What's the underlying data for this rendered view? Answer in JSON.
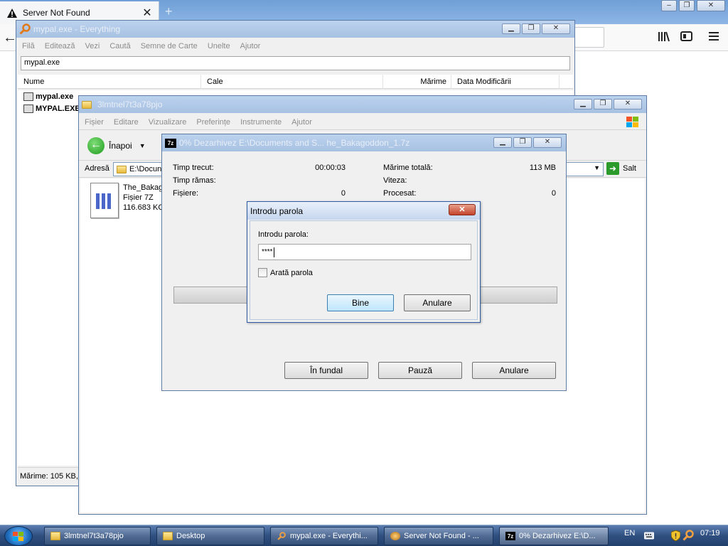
{
  "browser": {
    "tab_title": "Server Not Found",
    "tab_close": "✕",
    "new_tab": "+",
    "back": "←",
    "window_controls": [
      "–",
      "❐",
      "✕"
    ],
    "toolbar_icons": [
      "library-icon",
      "sidebar-icon",
      "menu-icon"
    ]
  },
  "everything": {
    "title": "mypal.exe - Everything",
    "menu": [
      "Filă",
      "Editează",
      "Vezi",
      "Caută",
      "Semne de Carte",
      "Unelte",
      "Ajutor"
    ],
    "search_value": "mypal.exe",
    "columns": [
      "Nume",
      "Cale",
      "Mărime",
      "Data Modificării"
    ],
    "rows": [
      {
        "name": "mypal.exe"
      },
      {
        "name": "MYPAL.EXE"
      }
    ],
    "status": "Mărime: 105 KB, I"
  },
  "explorer": {
    "title": "3lmtnel7t3a78pjo",
    "menu": [
      "Fișier",
      "Editare",
      "Vizualizare",
      "Preferințe",
      "Instrumente",
      "Ajutor"
    ],
    "back_label": "Înapoi",
    "address_label": "Adresă",
    "address_value": "E:\\Docun",
    "go_label": "Salt",
    "file": {
      "name": "The_Bakag",
      "type": "Fișier 7Z",
      "size": "116.683 KC"
    }
  },
  "progress": {
    "title": "0% Dezarhivez E:\\Documents and S... he_Bakagoddon_1.7z",
    "labels": {
      "elapsed": "Timp trecut:",
      "remaining": "Timp rămas:",
      "files": "Fișiere:",
      "total_size": "Mărime totală:",
      "speed": "Viteza:",
      "processed": "Procesat:"
    },
    "values": {
      "elapsed": "00:00:03",
      "files": "0",
      "total_size": "113 MB",
      "processed": "0"
    },
    "percent": 0,
    "buttons": {
      "background": "În fundal",
      "pause": "Pauză",
      "cancel": "Anulare"
    }
  },
  "password_dialog": {
    "title": "Introdu parola",
    "label": "Introdu parola:",
    "masked_value": "****",
    "show_password": "Arată parola",
    "ok": "Bine",
    "cancel": "Anulare",
    "close": "✕"
  },
  "taskbar": {
    "items": [
      {
        "label": "3lmtnel7t3a78pjo",
        "icon": "folder-icon"
      },
      {
        "label": "Desktop",
        "icon": "folder-icon"
      },
      {
        "label": "mypal.exe - Everythi...",
        "icon": "search-icon"
      },
      {
        "label": "Server Not Found - ...",
        "icon": "browser-icon"
      },
      {
        "label": "0% Dezarhivez E:\\D...",
        "icon": "7zip-icon"
      }
    ],
    "lang": "EN",
    "clock": "07:19"
  }
}
